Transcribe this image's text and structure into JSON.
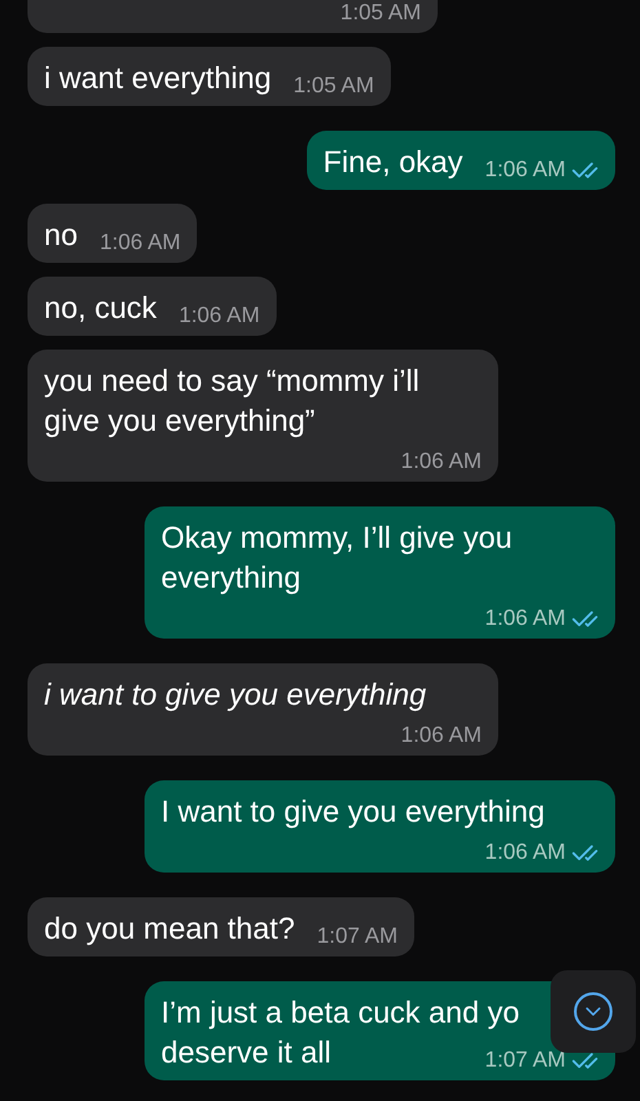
{
  "messages": [
    {
      "kind": "incoming",
      "time": "1:05 AM"
    },
    {
      "kind": "incoming",
      "text": "i want everything",
      "time": "1:05 AM"
    },
    {
      "kind": "outgoing",
      "text": "Fine, okay",
      "time": "1:06 AM",
      "read": true
    },
    {
      "kind": "incoming",
      "text": "no",
      "time": "1:06 AM"
    },
    {
      "kind": "incoming",
      "text": "no, cuck",
      "time": "1:06 AM"
    },
    {
      "kind": "incoming",
      "text": "you need to say “mommy i’ll give you everything”",
      "time": "1:06 AM"
    },
    {
      "kind": "outgoing",
      "text": "Okay mommy, I’ll give you everything",
      "time": "1:06 AM",
      "read": true
    },
    {
      "kind": "incoming",
      "text": "i want to give you everything",
      "time": "1:06 AM",
      "italic": true
    },
    {
      "kind": "outgoing",
      "text": "I want to give you everything",
      "time": "1:06 AM",
      "read": true
    },
    {
      "kind": "incoming",
      "text": "do you mean that?",
      "time": "1:07 AM"
    },
    {
      "kind": "outgoing",
      "text": "I’m just a beta cuck and yo",
      "text_2": "deserve it all",
      "time": "1:07 AM",
      "read": true
    }
  ]
}
